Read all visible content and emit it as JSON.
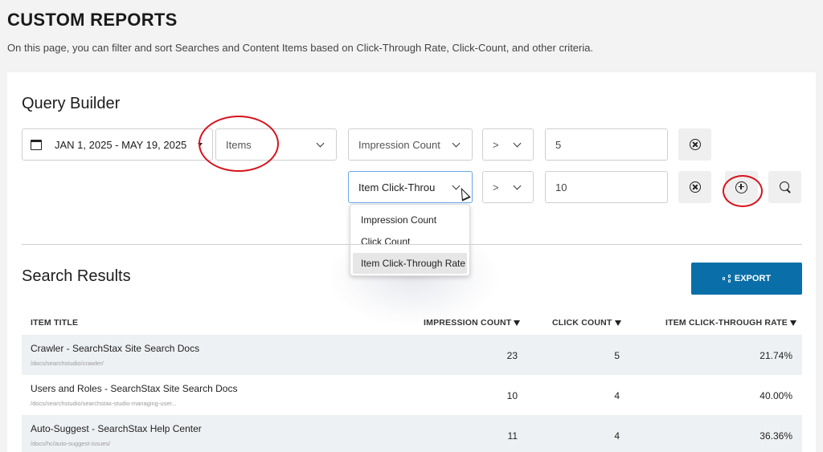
{
  "page": {
    "title": "CUSTOM REPORTS",
    "description": "On this page, you can filter and sort Searches and Content Items based on Click-Through Rate, Click-Count, and other criteria."
  },
  "query_builder": {
    "title": "Query Builder",
    "date_range": "JAN 1, 2025 - MAY 19, 2025",
    "type_select": "Items",
    "filter1": {
      "field": "Impression Count",
      "operator": ">",
      "value": "5"
    },
    "filter2": {
      "field": "Item Click-Throu",
      "operator": ">",
      "value": "10"
    },
    "field_dropdown_options": [
      "Impression Count",
      "Click Count",
      "Item Click-Through Rate"
    ],
    "selected_option": "Item Click-Through Rate"
  },
  "results": {
    "title": "Search Results",
    "export_label": "EXPORT",
    "columns": [
      "ITEM TITLE",
      "IMPRESSION COUNT",
      "CLICK COUNT",
      "ITEM CLICK-THROUGH RATE"
    ],
    "rows": [
      {
        "title": "Crawler - SearchStax Site Search Docs",
        "path": "/docs/searchstudio/crawler/",
        "impressions": "23",
        "clicks": "5",
        "ctr": "21.74%"
      },
      {
        "title": "Users and Roles - SearchStax Site Search Docs",
        "path": "/docs/searchstudio/searchstax-studio-managing-user...",
        "impressions": "10",
        "clicks": "4",
        "ctr": "40.00%"
      },
      {
        "title": "Auto-Suggest - SearchStax Help Center",
        "path": "/docs/hc/auto-suggest-issues/",
        "impressions": "11",
        "clicks": "4",
        "ctr": "36.36%"
      }
    ]
  },
  "colors": {
    "export_button": "#0a6fa8",
    "highlight_circle": "#d8121c",
    "row_alt": "#eef1f3"
  }
}
